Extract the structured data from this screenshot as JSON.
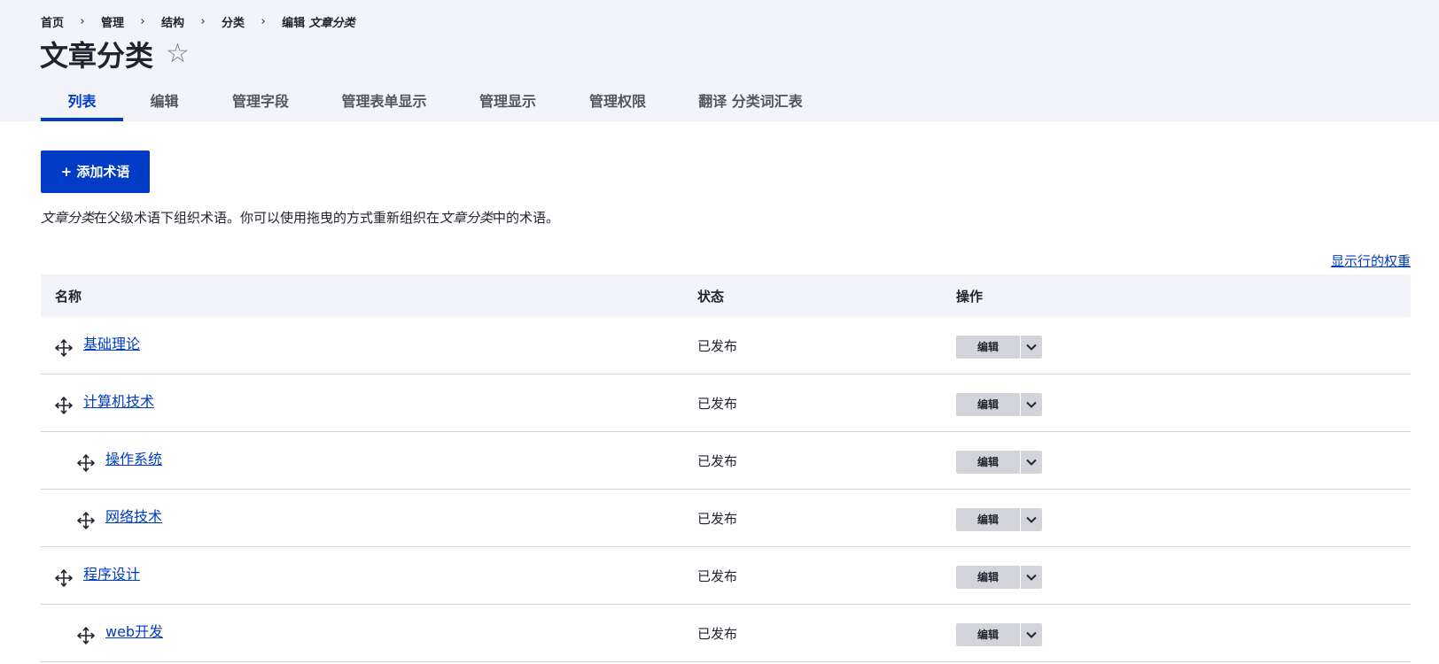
{
  "breadcrumb": {
    "items": [
      "首页",
      "管理",
      "结构",
      "分类"
    ],
    "current_prefix": "编辑",
    "current_em": "文章分类",
    "separator": "›"
  },
  "page": {
    "title": "文章分类",
    "star_icon": "star-outline-icon"
  },
  "tabs": [
    {
      "label": "列表",
      "active": true
    },
    {
      "label": "编辑",
      "active": false
    },
    {
      "label": "管理字段",
      "active": false
    },
    {
      "label": "管理表单显示",
      "active": false
    },
    {
      "label": "管理显示",
      "active": false
    },
    {
      "label": "管理权限",
      "active": false
    },
    {
      "label": "翻译 分类词汇表",
      "active": false
    }
  ],
  "actions": {
    "add_term_label": "+ 添加术语"
  },
  "description": {
    "em1": "文章分类",
    "text1": "在父级术语下组织术语。你可以使用拖曳的方式重新组织在",
    "em2": "文章分类",
    "text2": "中的术语。"
  },
  "show_weights_link": "显示行的权重",
  "table": {
    "headers": {
      "name": "名称",
      "status": "状态",
      "operations": "操作"
    },
    "rows": [
      {
        "name": "基础理论",
        "status": "已发布",
        "op": "编辑",
        "depth": 0
      },
      {
        "name": "计算机技术",
        "status": "已发布",
        "op": "编辑",
        "depth": 0
      },
      {
        "name": "操作系统",
        "status": "已发布",
        "op": "编辑",
        "depth": 1
      },
      {
        "name": "网络技术",
        "status": "已发布",
        "op": "编辑",
        "depth": 1
      },
      {
        "name": "程序设计",
        "status": "已发布",
        "op": "编辑",
        "depth": 0
      },
      {
        "name": "web开发",
        "status": "已发布",
        "op": "编辑",
        "depth": 1
      }
    ]
  },
  "colors": {
    "accent": "#003cc5",
    "header_bg": "#f3f4f9",
    "button_gray": "#d3d4d9"
  }
}
